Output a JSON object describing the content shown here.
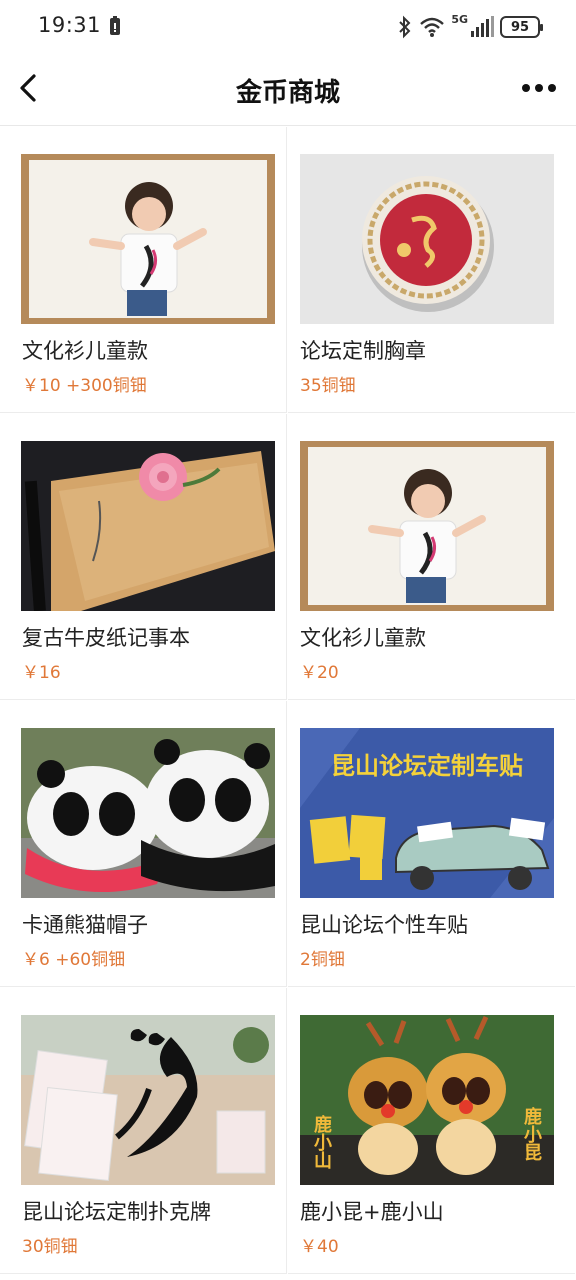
{
  "status_bar": {
    "time": "19:31",
    "network": "5G",
    "battery": "95",
    "icons": [
      "lock-icon",
      "bluetooth-icon",
      "wifi-icon",
      "signal-icon",
      "battery-icon"
    ]
  },
  "nav": {
    "title": "金币商城",
    "back_icon": "chevron-left-icon",
    "more_icon": "more-dots-icon"
  },
  "products": [
    {
      "name": "文化衫儿童款",
      "price": "￥10 +300铜钿",
      "image": "child-tshirt-photo"
    },
    {
      "name": "论坛定制胸章",
      "price": "35铜钿",
      "image": "badge-photo"
    },
    {
      "name": "复古牛皮纸记事本",
      "price": "￥16",
      "image": "kraft-notebook-photo"
    },
    {
      "name": "文化衫儿童款",
      "price": "￥20",
      "image": "child-tshirt-photo"
    },
    {
      "name": "卡通熊猫帽子",
      "price": "￥6 +60铜钿",
      "image": "panda-caps-photo"
    },
    {
      "name": "昆山论坛个性车贴",
      "price": "2铜钿",
      "image": "car-sticker-banner",
      "banner_text": "昆山论坛定制车贴"
    },
    {
      "name": "昆山论坛定制扑克牌",
      "price": "30铜钿",
      "image": "poker-cards-photo"
    },
    {
      "name": "鹿小昆+鹿小山",
      "price": "￥40",
      "image": "deer-plush-photo",
      "tag_left": "鹿小山",
      "tag_right": "鹿小昆"
    }
  ],
  "colors": {
    "price": "#e07838",
    "title": "#111111",
    "divider": "#ececec",
    "banner_bg": "#3c5aa8",
    "banner_text": "#f5d23a"
  }
}
